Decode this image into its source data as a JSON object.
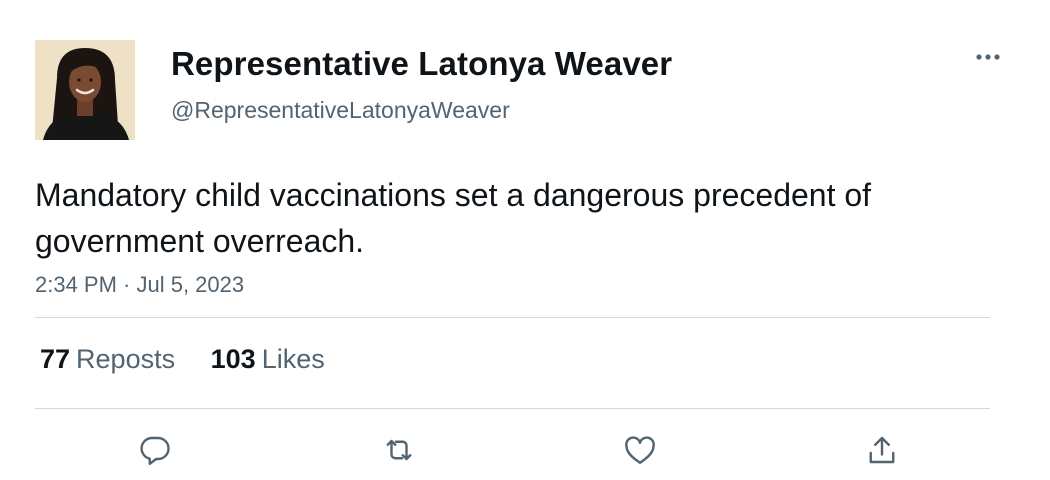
{
  "author": {
    "display_name": "Representative Latonya Weaver",
    "handle": "@RepresentativeLatonyaWeaver"
  },
  "tweet": {
    "text": "Mandatory child vaccinations set a dangerous precedent of government overreach.",
    "timestamp": "2:34 PM · Jul 5, 2023"
  },
  "stats": {
    "reposts_count": "77",
    "reposts_label": "Reposts",
    "likes_count": "103",
    "likes_label": "Likes"
  },
  "icons": {
    "more": "more-horizontal-icon",
    "reply": "reply-icon",
    "repost": "repost-icon",
    "like": "like-icon",
    "share": "share-icon"
  },
  "colors": {
    "primary_text": "#0f1419",
    "secondary_text": "#536471",
    "divider": "#cfd9de",
    "icon": "#536471"
  }
}
